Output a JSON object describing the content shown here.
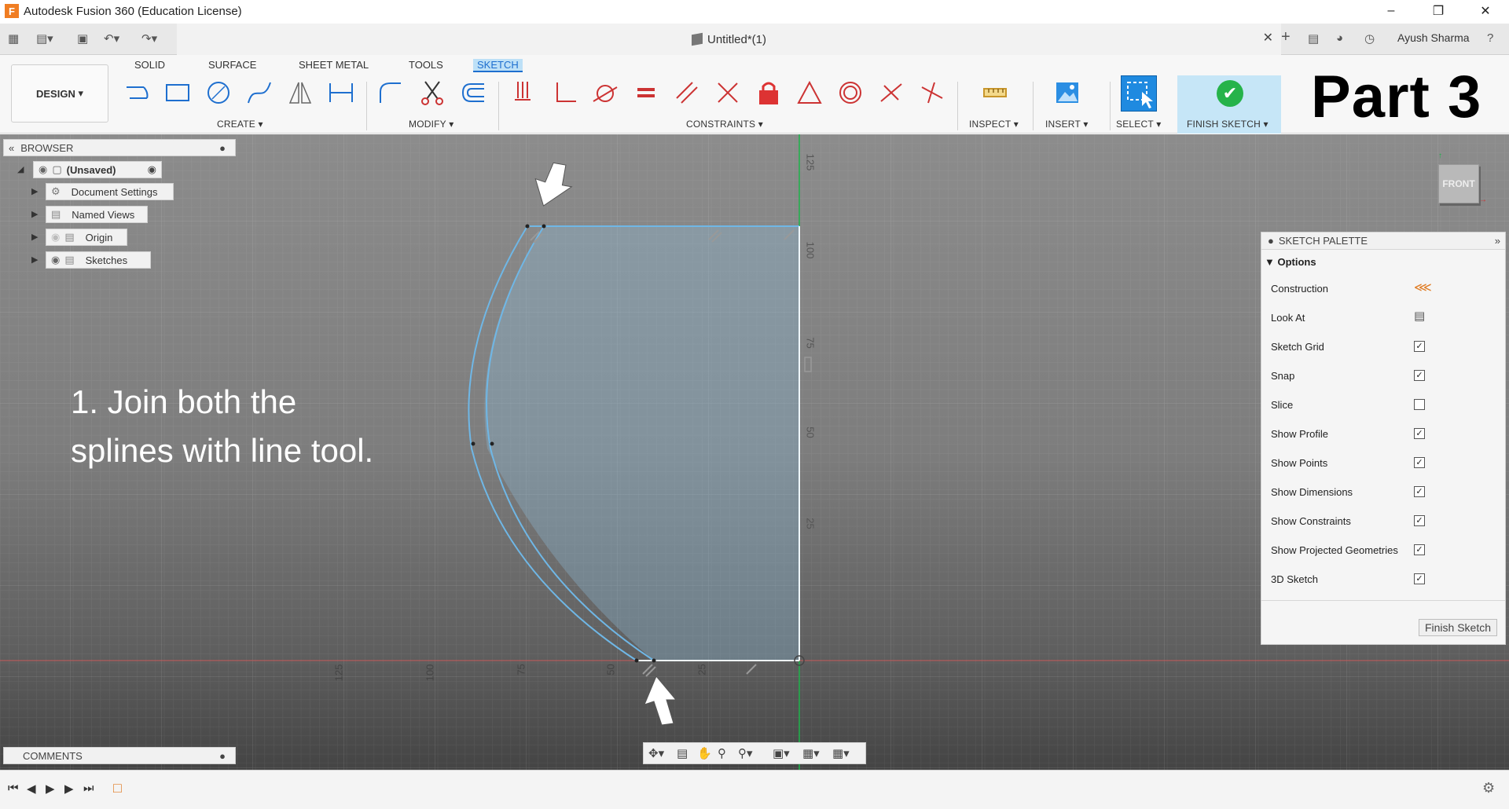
{
  "window": {
    "title": "Autodesk Fusion 360 (Education License)",
    "logo": "F"
  },
  "document": {
    "tab_title": "Untitled*(1)",
    "user": "Ayush Sharma"
  },
  "ribbon": {
    "workspace": "DESIGN",
    "tabs": [
      "SOLID",
      "SURFACE",
      "SHEET METAL",
      "TOOLS",
      "SKETCH"
    ],
    "active_tab": "SKETCH",
    "groups": {
      "create": "CREATE",
      "modify": "MODIFY",
      "constraints": "CONSTRAINTS",
      "inspect": "INSPECT",
      "insert": "INSERT",
      "select": "SELECT",
      "finish_sketch": "FINISH SKETCH"
    },
    "accent": "#1e6fcf",
    "finish_bg": "#c6e6f7"
  },
  "overlay": {
    "part_label": "Part 3",
    "instruction_line1": "1. Join both the",
    "instruction_line2": "splines with line tool."
  },
  "browser": {
    "header": "BROWSER",
    "root": "(Unsaved)",
    "items": [
      "Document Settings",
      "Named Views",
      "Origin",
      "Sketches"
    ]
  },
  "axis_ticks": {
    "vertical": [
      "125",
      "100",
      "75",
      "50",
      "25"
    ],
    "horizontal": [
      "125",
      "100",
      "75",
      "50",
      "25"
    ]
  },
  "viewcube": {
    "face": "FRONT"
  },
  "palette": {
    "header": "SKETCH PALETTE",
    "section": "Options",
    "rows": [
      {
        "label": "Construction",
        "control": "construction-icon"
      },
      {
        "label": "Look At",
        "control": "look-at-icon"
      },
      {
        "label": "Sketch Grid",
        "checked": true
      },
      {
        "label": "Snap",
        "checked": true
      },
      {
        "label": "Slice",
        "checked": false
      },
      {
        "label": "Show Profile",
        "checked": true
      },
      {
        "label": "Show Points",
        "checked": true
      },
      {
        "label": "Show Dimensions",
        "checked": true
      },
      {
        "label": "Show Constraints",
        "checked": true
      },
      {
        "label": "Show Projected Geometries",
        "checked": true
      },
      {
        "label": "3D Sketch",
        "checked": true
      }
    ],
    "finish_button": "Finish Sketch"
  },
  "comments": {
    "label": "COMMENTS"
  },
  "colors": {
    "sketch_line": "#6fb7e6",
    "green_axis": "#1db34a",
    "red_axis": "#c85a5a",
    "finish_check": "#26b34a",
    "select_blue": "#1f8ae0"
  }
}
